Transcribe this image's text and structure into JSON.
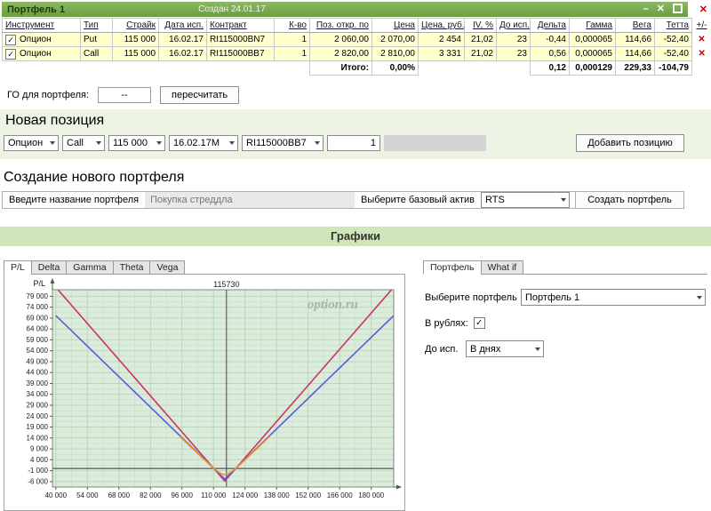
{
  "icons": {
    "check": "✓",
    "close": "✕",
    "minimize": "–"
  },
  "portfolio": {
    "title": "Портфель 1",
    "created": "Создан 24.01.17",
    "table": {
      "headers": [
        "Инструмент",
        "Тип",
        "Страйк",
        "Дата исп.",
        "Контракт",
        "К-во",
        "Поз. откр. по",
        "Цена",
        "Цена, руб.",
        "IV, %",
        "До исп.",
        "Дельта",
        "Гамма",
        "Вега",
        "Тетта"
      ],
      "plus_minus": "+/-",
      "rows": [
        {
          "instrument": "Опцион",
          "type": "Put",
          "strike": "115 000",
          "exp_date": "16.02.17",
          "contract": "RI115000BN7",
          "qty": "1",
          "open_pos": "2 060,00",
          "price": "2 070,00",
          "price_rub": "2 454",
          "iv": "21,02",
          "days": "23",
          "delta": "-0,44",
          "gamma": "0,000065",
          "vega": "114,66",
          "theta": "-52,40"
        },
        {
          "instrument": "Опцион",
          "type": "Call",
          "strike": "115 000",
          "exp_date": "16.02.17",
          "contract": "RI115000BB7",
          "qty": "1",
          "open_pos": "2 820,00",
          "price": "2 810,00",
          "price_rub": "3 331",
          "iv": "21,02",
          "days": "23",
          "delta": "0,56",
          "gamma": "0,000065",
          "vega": "114,66",
          "theta": "-52,40"
        }
      ],
      "totals": {
        "label": "Итого:",
        "iv": "0,00%",
        "delta": "0,12",
        "gamma": "0,000129",
        "vega": "229,33",
        "theta": "-104,79"
      }
    },
    "go": {
      "label": "ГО для портфеля:",
      "value": "--",
      "recalc": "пересчитать"
    }
  },
  "new_position": {
    "title": "Новая позиция",
    "selects": [
      "Опцион",
      "Call",
      "115 000",
      "16.02.17M",
      "RI115000BB7"
    ],
    "qty": "1",
    "add_button": "Добавить позицию"
  },
  "new_portfolio": {
    "title": "Создание нового портфеля",
    "name_label": "Введите название портфеля",
    "name_value": "Покупка стреддла",
    "asset_label": "Выберите базовый актив",
    "asset_value": "RTS",
    "create_button": "Создать портфель"
  },
  "charts": {
    "title": "Графики",
    "tabs": [
      "P/L",
      "Delta",
      "Gamma",
      "Theta",
      "Vega"
    ],
    "active_tab": "P/L"
  },
  "right_panel": {
    "tabs": [
      "Портфель",
      "What if"
    ],
    "active_tab": "Портфель",
    "portfolio_label": "Выберите портфель",
    "portfolio_value": "Портфель 1",
    "rubles_label": "В рублях:",
    "rubles_checked": true,
    "days_label": "До исп.",
    "days_value": "В днях"
  },
  "chart_data": {
    "type": "line",
    "title": "P/L",
    "axis_label": "P/L",
    "watermark": "option.ru",
    "xlim": [
      38500,
      190000
    ],
    "ylim": [
      -8500,
      82000
    ],
    "x_tick_values": [
      40000,
      54000,
      68000,
      82000,
      96000,
      110000,
      124000,
      138000,
      152000,
      166000,
      180000
    ],
    "x_tick_labels": [
      "40 000",
      "54 000",
      "68 000",
      "82 000",
      "96 000",
      "110 000",
      "124 000",
      "138 000",
      "152 000",
      "166 000",
      "180 000"
    ],
    "y_tick_values": [
      79000,
      74000,
      69000,
      64000,
      59000,
      54000,
      49000,
      44000,
      39000,
      34000,
      29000,
      24000,
      19000,
      14000,
      9000,
      4000,
      -1000,
      -6000
    ],
    "y_tick_labels": [
      "79 000",
      "74 000",
      "69 000",
      "64 000",
      "59 000",
      "54 000",
      "49 000",
      "44 000",
      "39 000",
      "34 000",
      "29 000",
      "24 000",
      "19 000",
      "14 000",
      "9 000",
      "4 000",
      "-1 000",
      "-6 000"
    ],
    "zero_line": 0,
    "marker_x": 115730,
    "marker_label": "115730",
    "colors": {
      "plot_bg": "#dcecdc",
      "grid_major": "#b9d6b9",
      "grid_minor": "#cde3cd",
      "border": "#7a8a7a",
      "marker": "#444444",
      "zero": "#333333"
    },
    "series": [
      {
        "name": "expiration-pl",
        "color": "#cc3366",
        "points": [
          [
            40000,
            83127
          ],
          [
            115000,
            -5785
          ],
          [
            190000,
            83140
          ]
        ]
      },
      {
        "name": "current-pl",
        "color": "#5b5bdc",
        "points": [
          [
            40000,
            70120
          ],
          [
            115000,
            -4880
          ],
          [
            190000,
            70120
          ]
        ]
      },
      {
        "name": "today-curve",
        "color": "#f09030",
        "points": [
          [
            95000,
            14776
          ],
          [
            97000,
            12793
          ],
          [
            99000,
            10814
          ],
          [
            101000,
            8841
          ],
          [
            103000,
            6878
          ],
          [
            105000,
            4928
          ],
          [
            107000,
            3001
          ],
          [
            109000,
            1120
          ],
          [
            111000,
            -663
          ],
          [
            113000,
            -2179
          ],
          [
            115000,
            -2880
          ],
          [
            117000,
            -2179
          ],
          [
            119000,
            -663
          ],
          [
            121000,
            1120
          ],
          [
            123000,
            3001
          ],
          [
            125000,
            4928
          ],
          [
            127000,
            6878
          ],
          [
            129000,
            8841
          ],
          [
            131000,
            10814
          ],
          [
            133000,
            12793
          ],
          [
            135000,
            14776
          ]
        ]
      }
    ]
  }
}
